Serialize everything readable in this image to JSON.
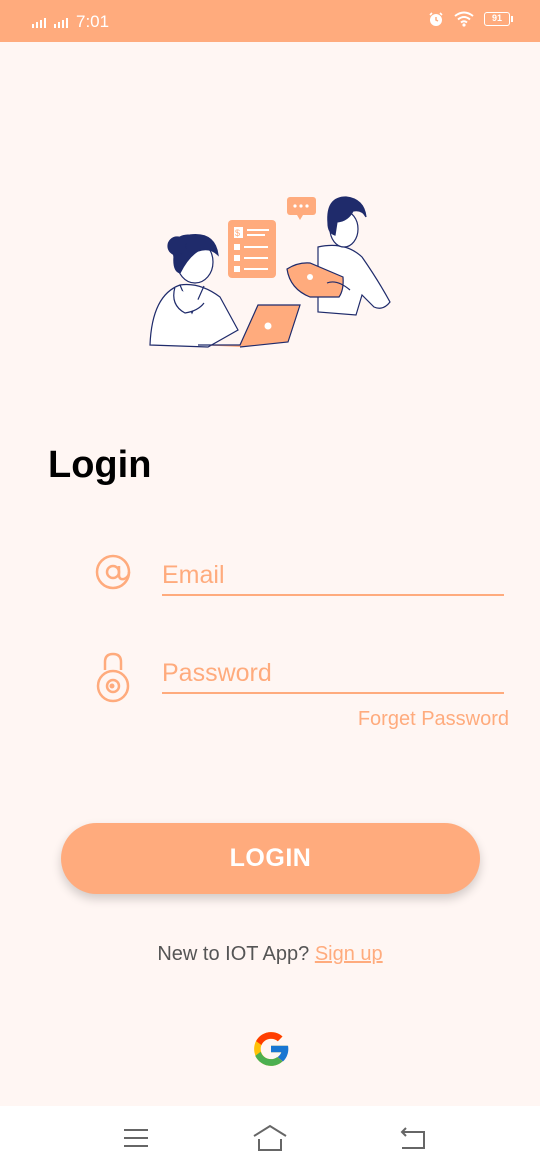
{
  "status_bar": {
    "time": "7:01",
    "battery": "91",
    "icons": [
      "signal-icon",
      "alarm-icon",
      "wifi-icon",
      "battery-icon"
    ],
    "color": "#ffab7d"
  },
  "login": {
    "title": "Login",
    "email_placeholder": "Email",
    "email_value": "",
    "password_placeholder": "Password",
    "password_value": "",
    "forget_password": "Forget Password",
    "button_label": "LOGIN",
    "new_user_prompt": "New to IOT App?",
    "signup_link": "Sign up"
  },
  "icons": {
    "email": "at-icon",
    "password": "lock-icon",
    "google": "google-icon"
  },
  "nav_bar": {
    "items": [
      "menu-icon",
      "home-icon",
      "back-icon"
    ]
  },
  "colors": {
    "accent": "#ffab7d",
    "background": "#fff6f3",
    "text": "#000000",
    "illustration_navy": "#1f2b6b"
  }
}
